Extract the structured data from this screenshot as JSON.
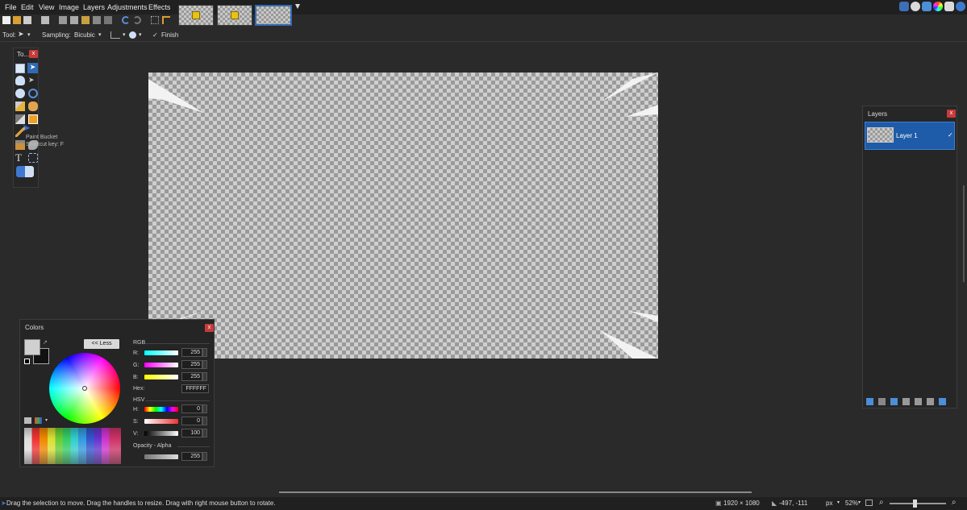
{
  "menu": {
    "items": [
      "File",
      "Edit",
      "View",
      "Image",
      "Layers",
      "Adjustments",
      "Effects"
    ]
  },
  "image_tabs": [
    {
      "name": "tab-image-1",
      "selected": false
    },
    {
      "name": "tab-image-2",
      "selected": false
    },
    {
      "name": "tab-image-3",
      "selected": true
    }
  ],
  "tool_options": {
    "tool_label": "Tool:",
    "sampling_label": "Sampling:",
    "sampling_value": "Bicubic",
    "finish_label": "Finish"
  },
  "tools_window": {
    "title": "To...",
    "close": "x",
    "tooltip_line1": "Paint Bucket",
    "tooltip_line2": "Shortcut key: F"
  },
  "colors_window": {
    "title": "Colors",
    "close": "x",
    "less_button": "<< Less",
    "rgb_label": "RGB",
    "r_label": "R:",
    "g_label": "G:",
    "b_label": "B:",
    "r_value": "255",
    "g_value": "255",
    "b_value": "255",
    "hex_label": "Hex:",
    "hex_value": "FFFFFF",
    "hsv_label": "HSV",
    "h_label": "H:",
    "s_label": "S:",
    "v_label": "V:",
    "h_value": "0",
    "s_value": "0",
    "v_value": "100",
    "opacity_label": "Opacity - Alpha",
    "alpha_value": "255"
  },
  "layers_window": {
    "title": "Layers",
    "close": "x",
    "layer_name": "Layer 1"
  },
  "status": {
    "hint": "Drag the selection to move. Drag the handles to resize. Drag with right mouse button to rotate.",
    "image_size": "1920 × 1080",
    "cursor_pos": "-497, -111",
    "unit": "px",
    "zoom": "52%"
  },
  "colors": {
    "accent_blue": "#1e5ba8",
    "close_red": "#c73b3b",
    "background": "#2a2a2a"
  }
}
